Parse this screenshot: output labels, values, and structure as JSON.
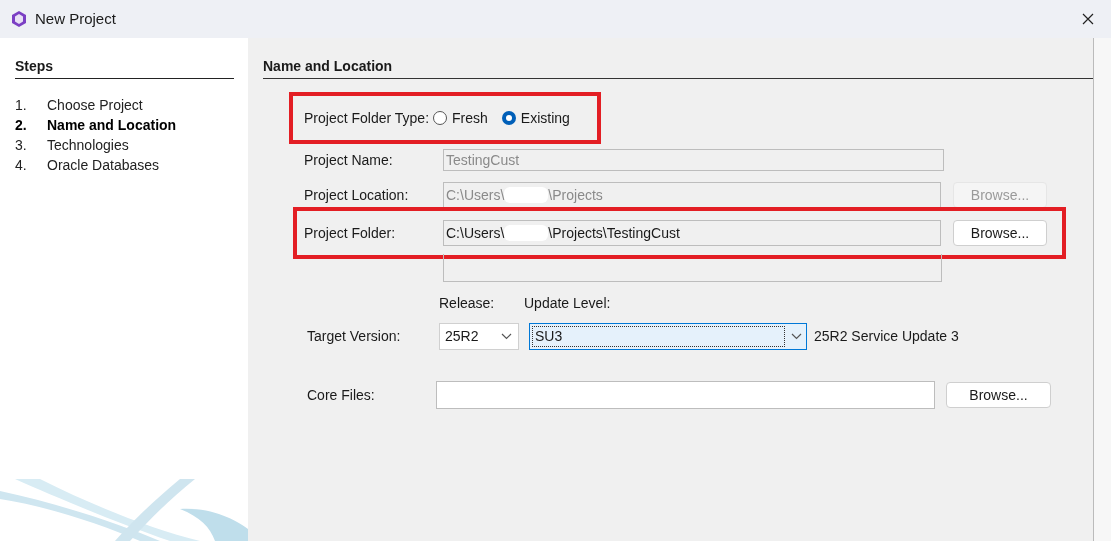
{
  "window": {
    "title": "New Project"
  },
  "steps": {
    "heading": "Steps",
    "items": [
      {
        "number": "1.",
        "label": "Choose Project",
        "selected": false
      },
      {
        "number": "2.",
        "label": "Name and Location",
        "selected": true
      },
      {
        "number": "3.",
        "label": "Technologies",
        "selected": false
      },
      {
        "number": "4.",
        "label": "Oracle Databases",
        "selected": false
      }
    ]
  },
  "section": {
    "heading": "Name and Location"
  },
  "folder_type": {
    "label": "Project Folder Type:",
    "options": [
      {
        "label": "Fresh",
        "selected": false
      },
      {
        "label": "Existing",
        "selected": true
      }
    ]
  },
  "project_name": {
    "label": "Project Name:",
    "value": "TestingCust",
    "disabled": true
  },
  "project_location": {
    "label": "Project Location:",
    "value_start": "C:\\Users\\",
    "value_end": "\\Projects",
    "disabled": true,
    "button": "Browse..."
  },
  "project_folder": {
    "label": "Project Folder:",
    "value_start": "C:\\Users\\",
    "value_end": "\\Projects\\TestingCust",
    "disabled": false,
    "button": "Browse..."
  },
  "target_version": {
    "label": "Target Version:",
    "release_label": "Release:",
    "release": "25R2",
    "update_label": "Update Level:",
    "update": "SU3",
    "description": "25R2 Service Update 3"
  },
  "core_files": {
    "label": "Core Files:",
    "button": "Browse..."
  }
}
